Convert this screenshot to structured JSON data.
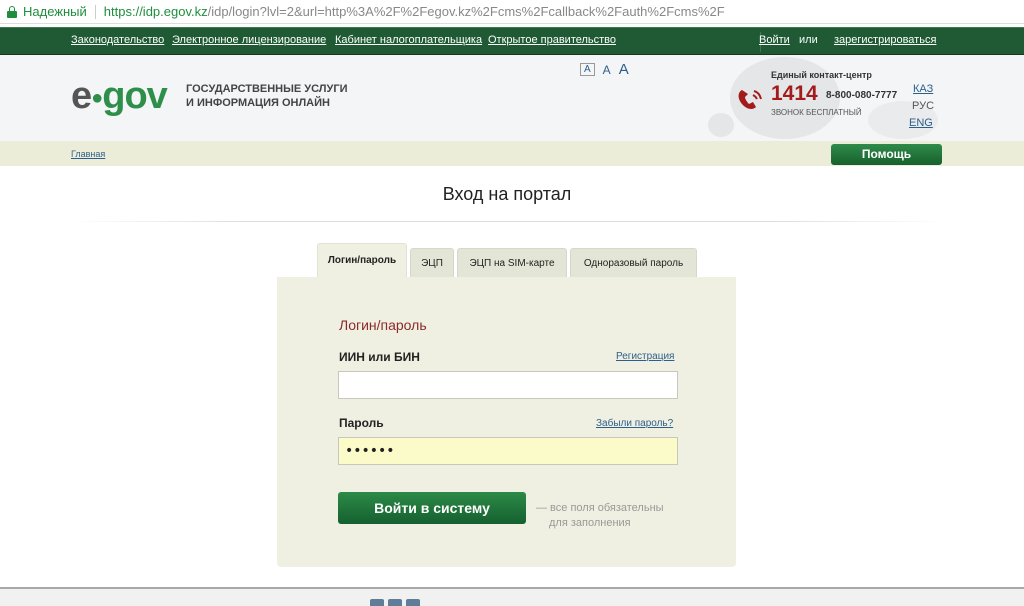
{
  "browser": {
    "secure_label": "Надежный",
    "url_host": "https://idp.egov.kz",
    "url_path": "/idp/login?lvl=2&url=http%3A%2F%2Fegov.kz%2Fcms%2Fcallback%2Fauth%2Fcms%2F"
  },
  "topnav": {
    "links": [
      "Законодательство",
      "Электронное лицензирование",
      "Кабинет налогоплательщика",
      "Открытое правительство"
    ],
    "login": "Войти",
    "or": "или",
    "register": "зарегистрироваться"
  },
  "header": {
    "logo_e": "e",
    "logo_dot": "●",
    "logo_gov": "gov",
    "tagline_line1": "ГОСУДАРСТВЕННЫЕ УСЛУГИ",
    "tagline_line2": "И ИНФОРМАЦИЯ ОНЛАЙН",
    "font_sizes": [
      "A",
      "A",
      "A"
    ],
    "contact_title": "Единый контакт-центр",
    "short_number": "1414",
    "long_number": "8-800-080-7777",
    "call_free": "ЗВОНОК БЕСПЛАТНЫЙ",
    "languages": [
      "КАЗ",
      "РУС",
      "ENG"
    ]
  },
  "breadcrumb": {
    "home": "Главная"
  },
  "help_button": "Помощь",
  "page_title": "Вход на портал",
  "tabs": [
    {
      "label": "Логин/пароль",
      "active": true
    },
    {
      "label": "ЭЦП",
      "active": false
    },
    {
      "label": "ЭЦП на SIM-карте",
      "active": false
    },
    {
      "label": "Одноразовый пароль",
      "active": false
    }
  ],
  "form": {
    "title": "Логин/пароль",
    "iin_label": "ИИН или БИН",
    "register_link": "Регистрация",
    "iin_value": "",
    "password_label": "Пароль",
    "forgot_link": "Забыли пароль?",
    "password_value": "••••••",
    "submit": "Войти в систему",
    "note_line1": "— все поля обязательны",
    "note_line2": "для заполнения"
  },
  "colors": {
    "brand_green": "#1f5a34",
    "accent_red": "#a31b1b",
    "link_blue": "#2d5f8c"
  }
}
